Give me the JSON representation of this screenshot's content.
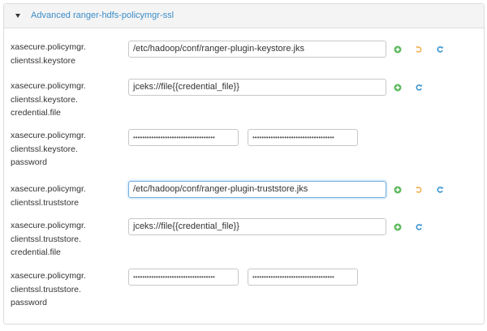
{
  "section": {
    "title": "Advanced ranger-hdfs-policymgr-ssl"
  },
  "fields": [
    {
      "label_lines": [
        "xasecure.policymgr.",
        "clientssl.keystore"
      ],
      "value": "/etc/hadoop/conf/ranger-plugin-keystore.jks",
      "actions": [
        "plus-icon",
        "undo-icon",
        "refresh-icon"
      ]
    },
    {
      "label_lines": [
        "xasecure.policymgr.",
        "clientssl.keystore.",
        "credential.file"
      ],
      "value": "jceks://file{{credential_file}}",
      "actions": [
        "plus-icon",
        "refresh-icon"
      ]
    },
    {
      "label_lines": [
        "xasecure.policymgr.",
        "clientssl.keystore.",
        "password"
      ],
      "password_masked": "••••••••••••••••••••••••••••••••••••",
      "confirm_masked": "••••••••••••••••••••••••••••••••••••"
    },
    {
      "label_lines": [
        "xasecure.policymgr.",
        "clientssl.truststore"
      ],
      "value": "/etc/hadoop/conf/ranger-plugin-truststore.jks",
      "actions": [
        "plus-icon",
        "undo-icon",
        "refresh-icon"
      ]
    },
    {
      "label_lines": [
        "xasecure.policymgr.",
        "clientssl.truststore.",
        "credential.file"
      ],
      "value": "jceks://file{{credential_file}}",
      "actions": [
        "plus-icon",
        "refresh-icon"
      ]
    },
    {
      "label_lines": [
        "xasecure.policymgr.",
        "clientssl.truststore.",
        "password"
      ],
      "password_masked": "••••••••••••••••••••••••••••••••••••",
      "confirm_masked": "••••••••••••••••••••••••••••••••••••"
    }
  ],
  "colors": {
    "link": "#3a8dc8",
    "plus": "#5cb85c",
    "undo": "#f0ad4e",
    "refresh": "#2f8fd0"
  }
}
